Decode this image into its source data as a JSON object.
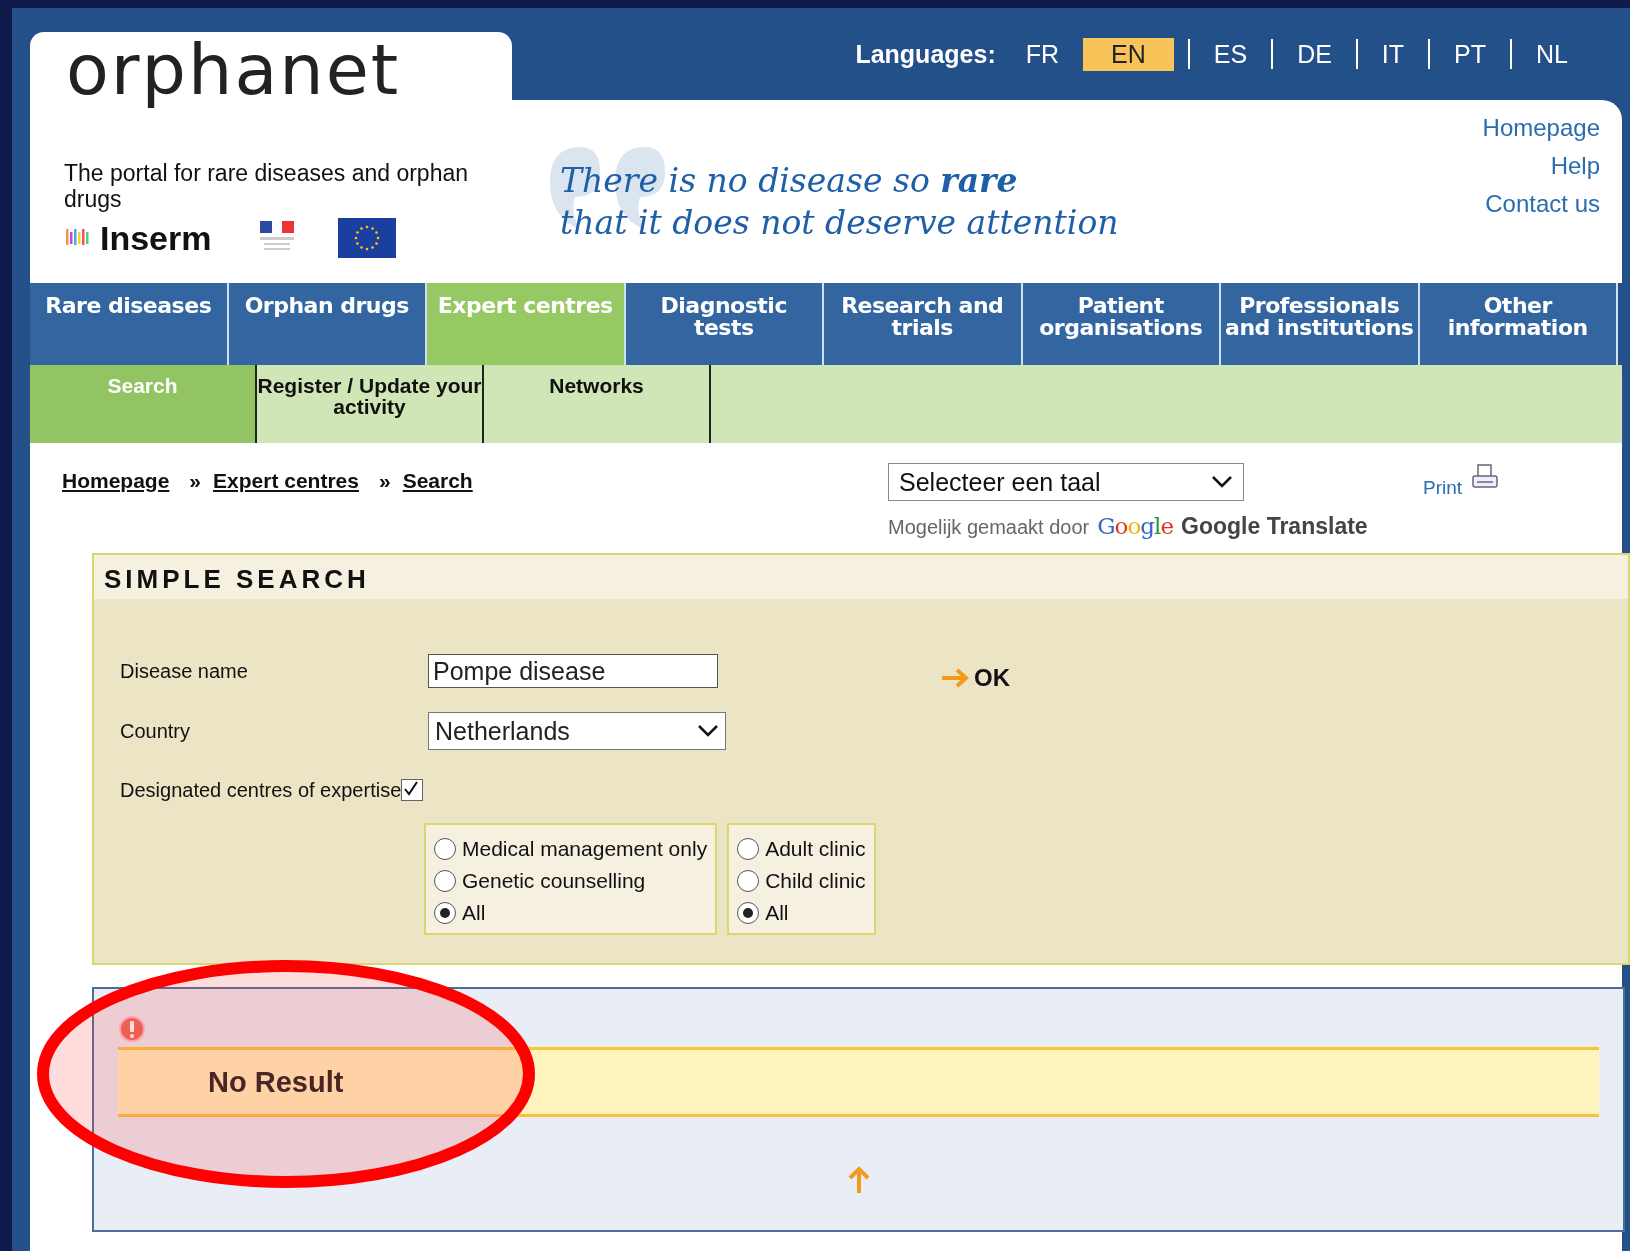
{
  "header": {
    "logo": "orphanet",
    "tagline": "The portal for rare diseases and orphan drugs",
    "partner_logo": "Inserm",
    "quote_lines": [
      "There is no disease so **rare**",
      "that it does not deserve attention"
    ],
    "languages_label": "Languages:",
    "languages": [
      {
        "label": "FR",
        "selected": false
      },
      {
        "label": "EN",
        "selected": true
      },
      {
        "label": "ES",
        "selected": false
      },
      {
        "label": "DE",
        "selected": false
      },
      {
        "label": "IT",
        "selected": false
      },
      {
        "label": "PT",
        "selected": false
      },
      {
        "label": "NL",
        "selected": false
      }
    ],
    "links": [
      "Homepage",
      "Help",
      "Contact us"
    ]
  },
  "nav": [
    {
      "label": "Rare diseases",
      "selected": false
    },
    {
      "label": "Orphan drugs",
      "selected": false
    },
    {
      "label": "Expert centres",
      "selected": true
    },
    {
      "label": "Diagnostic tests",
      "selected": false
    },
    {
      "label": "Research and trials",
      "selected": false
    },
    {
      "label": "Patient organisations",
      "selected": false
    },
    {
      "label": "Professionals and institutions",
      "selected": false
    },
    {
      "label": "Other information",
      "selected": false
    }
  ],
  "subnav": [
    {
      "label": "Search",
      "selected": true
    },
    {
      "label": "Register / Update your activity",
      "selected": false
    },
    {
      "label": "Networks",
      "selected": false
    }
  ],
  "breadcrumbs": [
    "Homepage",
    "Expert centres",
    "Search"
  ],
  "breadcrumb_separator": "»",
  "translate": {
    "value": "Selecteer een taal",
    "powered_by": "Mogelijk gemaakt door",
    "google": "Google",
    "service": "Google Translate"
  },
  "print": "Print",
  "search": {
    "title": "SIMPLE SEARCH",
    "disease_label": "Disease name",
    "disease_value": "Pompe disease",
    "country_label": "Country",
    "country_value": "Netherlands",
    "designated_label": "Designated centres of expertise",
    "designated_checked": true,
    "ok": "OK",
    "care_options": [
      {
        "label": "Medical management only",
        "selected": false
      },
      {
        "label": "Genetic counselling",
        "selected": false
      },
      {
        "label": "All",
        "selected": true
      }
    ],
    "clinic_options": [
      {
        "label": "Adult clinic",
        "selected": false
      },
      {
        "label": "Child clinic",
        "selected": false
      },
      {
        "label": "All",
        "selected": true
      }
    ]
  },
  "result": {
    "message": "No Result"
  }
}
